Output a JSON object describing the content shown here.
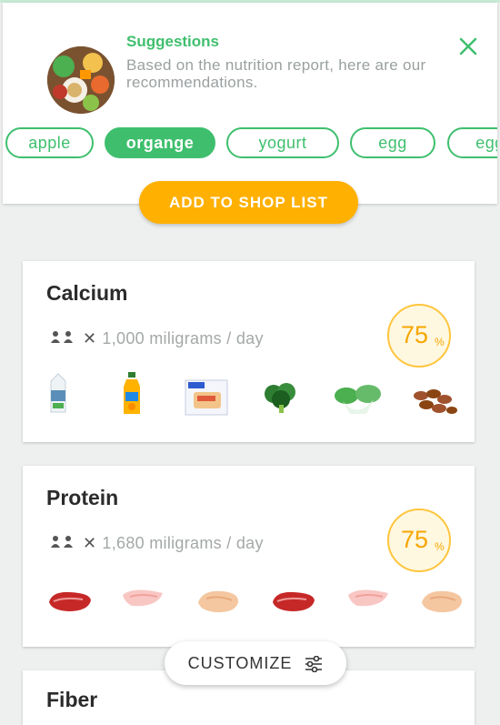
{
  "suggestions": {
    "title": "Suggestions",
    "description": "Based on the nutrition report, here are our recommendations.",
    "chips": [
      {
        "label": "apple",
        "selected": false
      },
      {
        "label": "organge",
        "selected": true
      },
      {
        "label": "yogurt",
        "selected": false
      },
      {
        "label": "egg",
        "selected": false
      },
      {
        "label": "egg",
        "selected": false
      }
    ]
  },
  "actions": {
    "shop_label": "ADD TO SHOP LIST",
    "customize_label": "CUSTOMIZE"
  },
  "nutrients": [
    {
      "title": "Calcium",
      "amount": "1,000 miligrams / day",
      "percent": "75",
      "percent_symbol": "%",
      "foods": [
        "milk-carton-icon",
        "orange-juice-icon",
        "tofu-icon",
        "broccoli-icon",
        "bok-choy-icon",
        "almonds-icon"
      ]
    },
    {
      "title": "Protein",
      "amount": "1,680 miligrams / day",
      "percent": "75",
      "percent_symbol": "%",
      "foods": [
        "steak-icon",
        "fish-fillet-icon",
        "chicken-breast-icon",
        "steak-icon",
        "fish-fillet-icon",
        "chicken-breast-icon"
      ]
    },
    {
      "title": "Fiber"
    }
  ],
  "colors": {
    "accent_green": "#3fbf6e",
    "accent_orange": "#ffb000",
    "background": "#eef0ef"
  }
}
